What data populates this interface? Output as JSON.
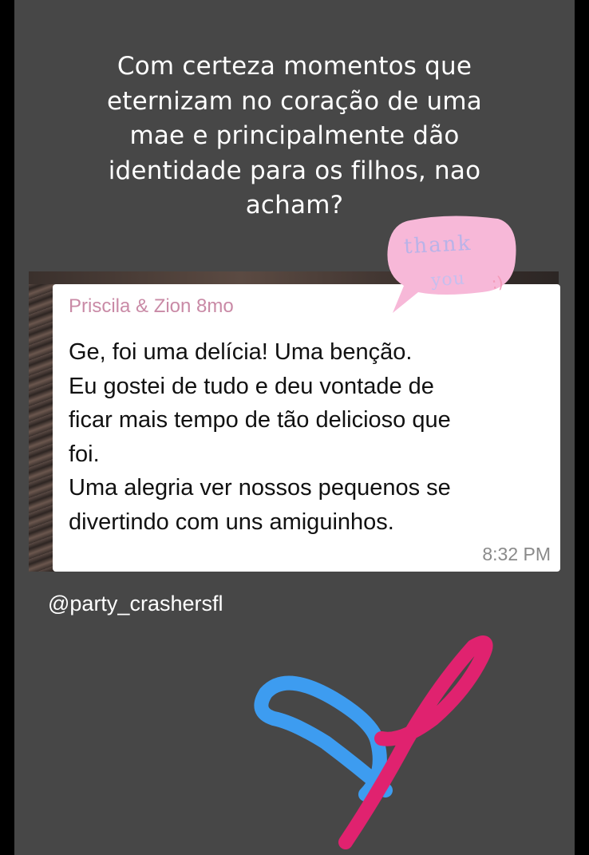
{
  "story": {
    "caption_lines": [
      "Com certeza momentos que",
      "eternizam no coração de uma",
      "mae e principalmente dão",
      "identidade para os filhos, nao",
      "acham?"
    ],
    "handle": "@party_crashersfl"
  },
  "message": {
    "sender": "Priscila & Zion 8mo",
    "lines": [
      "Ge, foi uma delícia! Uma benção.",
      "Eu gostei de tudo e deu vontade de",
      "ficar mais tempo de tão delicioso que",
      "foi.",
      "Uma alegria ver nossos pequenos se",
      "divertindo com uns amiguinhos."
    ],
    "time": "8:32 PM"
  },
  "sticker": {
    "line1": "thank",
    "line2": "you",
    "smile": ":)",
    "bubble_color": "#f7b8d8"
  },
  "colors": {
    "background": "#474747",
    "heart_blue": "#3d9cf0",
    "heart_pink": "#e0226f"
  }
}
